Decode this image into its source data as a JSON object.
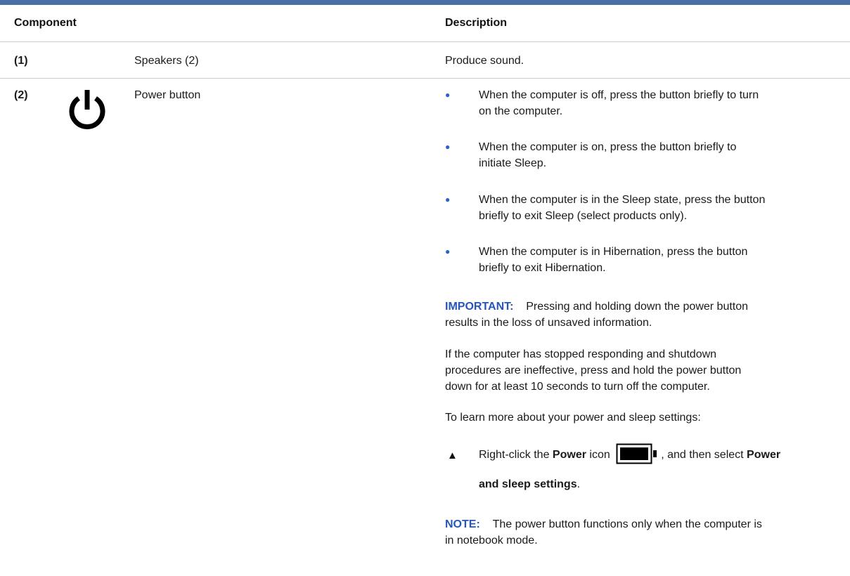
{
  "table": {
    "header": {
      "component": "Component",
      "description": "Description"
    },
    "rows": [
      {
        "num": "(1)",
        "name": "Speakers (2)",
        "desc": "Produce sound."
      },
      {
        "num": "(2)",
        "icon": "power-icon",
        "name": "Power button"
      }
    ]
  },
  "power": {
    "bullets": [
      {
        "line1": "When the computer is off, press the button briefly to turn",
        "line2": "on the computer."
      },
      {
        "line1": "When the computer is on, press the button briefly to",
        "line2": "initiate Sleep."
      },
      {
        "line1": "When the computer is in the Sleep state, press the button",
        "line2": "briefly to exit Sleep (select products only)."
      },
      {
        "line1": "When the computer is in Hibernation, press the button",
        "line2": "briefly to exit Hibernation."
      }
    ],
    "important": {
      "label": "IMPORTANT:",
      "line1": "Pressing and holding down the power button",
      "line2": "results in the loss of unsaved information."
    },
    "para1": {
      "line1": "If the computer has stopped responding and shutdown",
      "line2": "procedures are ineffective, press and hold the power button",
      "line3": "down for at least 10 seconds to turn off the computer."
    },
    "para2": "To learn more about your power and sleep settings:",
    "step": {
      "marker": "▲",
      "pre": "Right-click the ",
      "power_word": "Power",
      "icon_word": " icon",
      "icon": "battery-icon",
      "post": ", and then select ",
      "setting_part1": "Power",
      "setting_part2": "and sleep settings",
      "end": "."
    },
    "note": {
      "label": "NOTE:",
      "line1": "The power button functions only when the computer is",
      "line2": "in notebook mode."
    }
  },
  "colors": {
    "accent": "#4a6fa5",
    "bullet": "#2b63c4",
    "label": "#2556b8"
  }
}
